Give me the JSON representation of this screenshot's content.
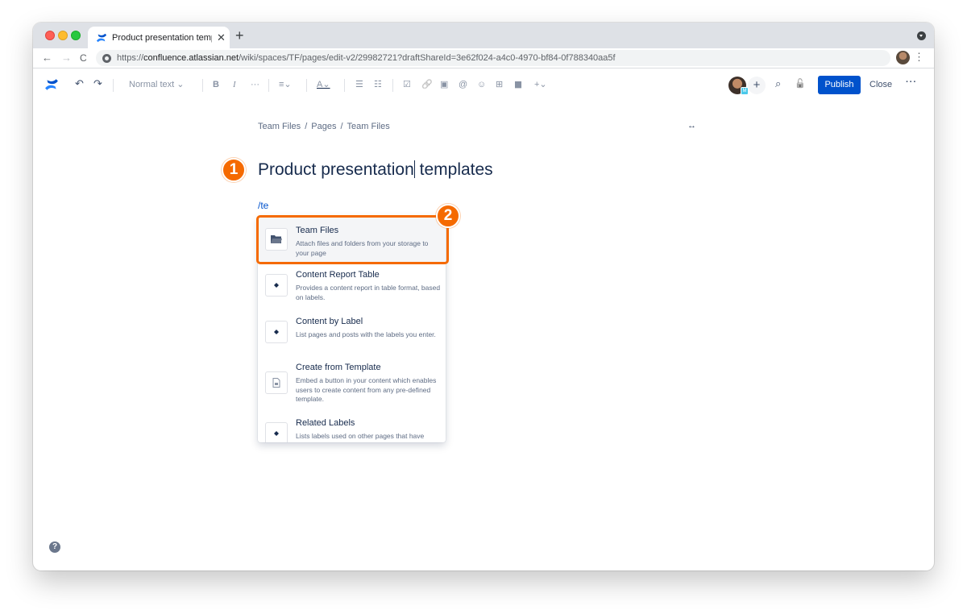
{
  "browser": {
    "tab_title": "Product presentation template",
    "tab_close": "✕",
    "new_tab": "+",
    "nav_back": "←",
    "nav_forward": "→",
    "nav_reload": "C",
    "url_prefix": "https://",
    "url_host": "confluence.atlassian.net",
    "url_path": "/wiki/spaces/TF/pages/edit-v2/29982721?draftShareId=3e62f024-a4c0-4970-bf84-0f788340aa5f",
    "menu": "⋮"
  },
  "toolbar": {
    "undo": "↶",
    "redo": "↷",
    "text_style": "Normal text ⌄",
    "bold": "B",
    "italic": "I",
    "more_formatting": "···",
    "align": "≡⌄",
    "text_color": "A⌄",
    "bullet_list": "☰",
    "numbered_list": "☷",
    "action_item": "☑",
    "link": "🔗",
    "image": "▣",
    "mention": "@",
    "emoji": "☺",
    "table": "⊞",
    "layouts": "▮▮",
    "insert": "+⌄",
    "invite": "+",
    "search": "⌕",
    "restrictions": "🔓",
    "publish": "Publish",
    "close": "Close",
    "more": "···",
    "user_badge": "M"
  },
  "breadcrumb": [
    "Team Files",
    "Pages",
    "Team Files"
  ],
  "breadcrumb_sep": "/",
  "width_toggle": "↔",
  "page_title_before": "Product presentation",
  "page_title_after": " templates",
  "slash_command": "/te",
  "badges": [
    "1",
    "2"
  ],
  "menu_items": [
    {
      "title": "Team Files",
      "desc": "Attach files and folders from your storage to your page",
      "icon": "folder-icon"
    },
    {
      "title": "Content Report Table",
      "desc": "Provides a content report in table format, based on labels.",
      "icon": "puzzle-icon"
    },
    {
      "title": "Content by Label",
      "desc": "List pages and posts with the labels you enter.",
      "icon": "puzzle-icon"
    },
    {
      "title": "Create from Template",
      "desc": "Embed a button in your content which enables users to create content from any pre-defined template.",
      "icon": "template-icon"
    },
    {
      "title": "Related Labels",
      "desc": "Lists labels used on other pages that have",
      "icon": "puzzle-icon"
    }
  ],
  "help": "?",
  "colors": {
    "accent": "#0052cc",
    "highlight": "#f56a00",
    "title": "#172b4d"
  }
}
